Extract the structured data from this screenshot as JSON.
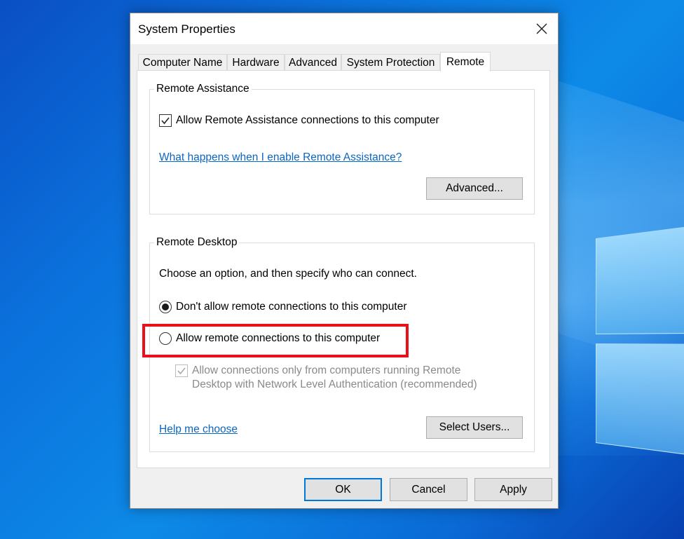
{
  "window": {
    "title": "System Properties",
    "close_icon": "close-icon"
  },
  "tabs": [
    {
      "label": "Computer Name",
      "active": false
    },
    {
      "label": "Hardware",
      "active": false
    },
    {
      "label": "Advanced",
      "active": false
    },
    {
      "label": "System Protection",
      "active": false
    },
    {
      "label": "Remote",
      "active": true
    }
  ],
  "remote_assistance": {
    "group_label": "Remote Assistance",
    "allow_checkbox_label": "Allow Remote Assistance connections to this computer",
    "allow_checked": true,
    "help_link": "What happens when I enable Remote Assistance?",
    "advanced_button": "Advanced..."
  },
  "remote_desktop": {
    "group_label": "Remote Desktop",
    "instruction": "Choose an option, and then specify who can connect.",
    "options": [
      {
        "label": "Don't allow remote connections to this computer",
        "selected": true
      },
      {
        "label": "Allow remote connections to this computer",
        "selected": false
      }
    ],
    "nla_checkbox_line1": "Allow connections only from computers running Remote",
    "nla_checkbox_line2": "Desktop with Network Level Authentication (recommended)",
    "nla_checked": true,
    "nla_enabled": false,
    "help_link": "Help me choose",
    "select_users_button": "Select Users..."
  },
  "footer": {
    "ok_label": "OK",
    "cancel_label": "Cancel",
    "apply_label": "Apply"
  },
  "colors": {
    "highlight": "#e8101b",
    "link": "#0b66c2",
    "focus_border": "#0078d7"
  }
}
